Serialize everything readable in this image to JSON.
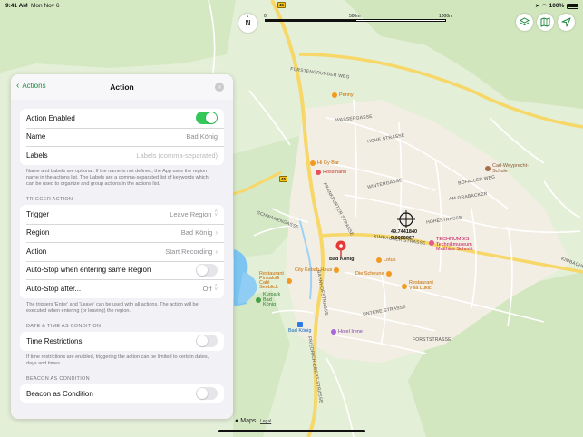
{
  "status_bar": {
    "time": "9:41 AM",
    "date": "Mon Nov 6",
    "battery": "100%"
  },
  "map": {
    "compass_label": "N",
    "scale_labels": [
      "0",
      "500m",
      "1000m"
    ],
    "road_numbers": [
      "45",
      "45"
    ],
    "street_labels": [
      "FÜRSTENGRUNDER WEG",
      "WASSERGASSE",
      "HOHE STRASSE",
      "BOFALLER WEG",
      "WINTERGASSE",
      "AM GRABACKER",
      "BAHNHOFSTRASSE",
      "FRANKFURTER STRASSE",
      "SCHWANENGASSE",
      "FRIEDRICH-EBERT-STRASSE",
      "KIMBACHER STRASSE",
      "HOHESTRASSE",
      "UNTERE STRASSE",
      "FORSTSTRASSE",
      "KIMBACHER"
    ],
    "pois": [
      {
        "name": "Penny",
        "kind": "orange"
      },
      {
        "name": "Hi Gy Bar",
        "kind": "orange"
      },
      {
        "name": "Rossmann",
        "kind": "red"
      },
      {
        "name": "Carl-Weyprecht-Schule",
        "kind": "brown"
      },
      {
        "name": "TECHNUMBIS Technikmuseum Matthias Schmitt",
        "kind": "pink"
      },
      {
        "name": "Lotus",
        "kind": "orange"
      },
      {
        "name": "City Kebab Haus",
        "kind": "orange"
      },
      {
        "name": "Die Scheune",
        "kind": "orange"
      },
      {
        "name": "Restaurant Pinsaloffi Café Seeblick",
        "kind": "orange"
      },
      {
        "name": "Kurpark Bad König",
        "kind": "green"
      },
      {
        "name": "Restaurant Villa Lukic",
        "kind": "orange"
      },
      {
        "name": "Bad König",
        "kind": "blue"
      },
      {
        "name": "Hotel Irene",
        "kind": "purple"
      }
    ],
    "coordinates": [
      "49.7441840",
      "9.0099967"
    ],
    "pin_label": "Bad König",
    "maps_logo": "Maps",
    "legal": "Legal",
    "colors": {
      "land": "#e4efd8",
      "forest": "#c9e2b4",
      "road_major": "#f6d768",
      "road": "#ffffff",
      "water": "#7cc4f2",
      "town": "#f5efe2",
      "pin": "#e53935",
      "accent": "#1f8a3e"
    }
  },
  "panel": {
    "back_label": "Actions",
    "title": "Action",
    "action_enabled": {
      "label": "Action Enabled",
      "on": true
    },
    "name": {
      "label": "Name",
      "value": "Bad König"
    },
    "labels": {
      "label": "Labels",
      "placeholder": "Labels (comma-separated)"
    },
    "name_footnote": "Name and Labels are optional. If the name is not defined, the App uses the region name in the actions list. The Labels are a comma-separated list of keywords which can be used to organize and group actions in the actions list.",
    "trigger_section": "TRIGGER ACTION",
    "trigger": {
      "label": "Trigger",
      "value": "Leave Region"
    },
    "region": {
      "label": "Region",
      "value": "Bad König"
    },
    "action": {
      "label": "Action",
      "value": "Start Recording"
    },
    "auto_stop_same": {
      "label": "Auto-Stop when entering same Region",
      "on": false
    },
    "auto_stop_after": {
      "label": "Auto-Stop after...",
      "value": "Off"
    },
    "trigger_footnote": "The triggers 'Enter' and 'Leave' can be used with all actions. The action will be executed when entering (or leaving) the region.",
    "datetime_section": "DATE & TIME AS CONDITION",
    "time_restrictions": {
      "label": "Time Restrictions",
      "on": false
    },
    "time_footnote": "If time restrictions are enabled, triggering the action can be limited to certain dates, days and times.",
    "beacon_section": "BEACON AS CONDITION",
    "beacon": {
      "label": "Beacon as Condition",
      "on": false
    }
  }
}
